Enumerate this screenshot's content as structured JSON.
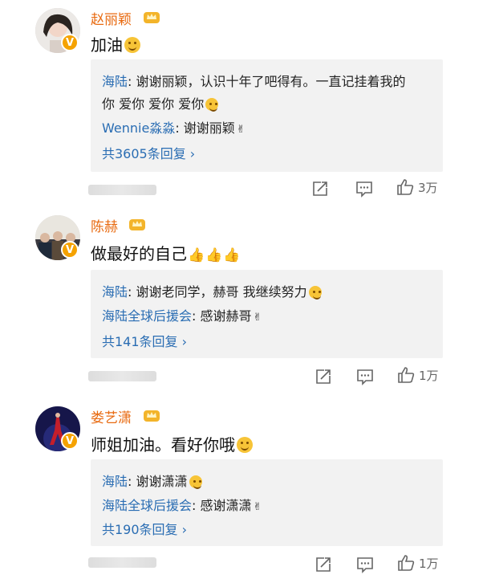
{
  "comments": [
    {
      "username": "赵丽颖",
      "text": "加油",
      "replies": [
        {
          "name": "海陆",
          "text": "谢谢丽颖，认识十年了吧得有。一直记挂着我的"
        },
        {
          "name": "",
          "text": "你 爱你 爱你 爱你"
        },
        {
          "name": "Wennie淼淼",
          "text": "谢谢丽颖"
        }
      ],
      "more_replies": "共3605条回复 ›",
      "likes": "3万"
    },
    {
      "username": "陈赫",
      "text": "做最好的自己",
      "replies": [
        {
          "name": "海陆",
          "text": "谢谢老同学，赫哥 我继续努力"
        },
        {
          "name": "海陆全球后援会",
          "text": "感谢赫哥"
        }
      ],
      "more_replies": "共141条回复 ›",
      "likes": "1万"
    },
    {
      "username": "娄艺潇",
      "text": "师姐加油。看好你哦",
      "replies": [
        {
          "name": "海陆",
          "text": "谢谢潇潇"
        },
        {
          "name": "海陆全球后援会",
          "text": "感谢潇潇"
        }
      ],
      "more_replies": "共190条回复 ›",
      "likes": "1万"
    }
  ],
  "icons": {
    "share": "share-icon",
    "comment": "comment-icon",
    "like": "thumbs-up-icon",
    "verified": "verified-badge-icon",
    "crown": "crown-icon"
  },
  "colors": {
    "username": "#e86a10",
    "reply_name": "#2a6db3",
    "reply_bg": "#f2f2f2",
    "verified": "#f5a200"
  }
}
